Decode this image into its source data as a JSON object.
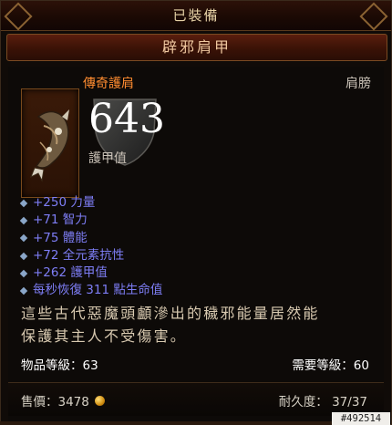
{
  "header": {
    "equipped": "已裝備"
  },
  "item": {
    "name": "辟邪肩甲",
    "type": "傳奇護肩",
    "slot": "肩膀",
    "icon": "shoulder-armor-icon",
    "armor_value": "643",
    "armor_label": "護甲值",
    "stats": [
      "+250 力量",
      "+71 智力",
      "+75 體能",
      "+72 全元素抗性",
      "+262 護甲值",
      "每秒恢復 311 點生命值"
    ],
    "flavor_lines": [
      "這些古代惡魔頭顱滲出的穢邪能量居然能",
      "保護其主人不受傷害。"
    ],
    "item_level": "物品等級：63",
    "required_level": "需要等級：60",
    "price": "售價：3478",
    "durability": "耐久度： 37/37"
  },
  "watermark": "#492514",
  "colors": {
    "legendary": "#ff8c30",
    "magic_stat": "#7e7ef6",
    "flavor": "#d8c9b0",
    "gold": "#d08c10"
  }
}
